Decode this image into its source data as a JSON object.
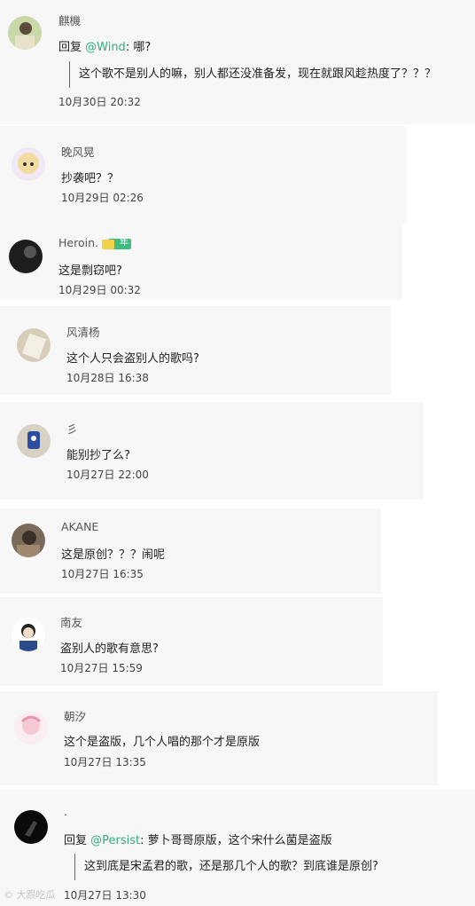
{
  "comments": [
    {
      "user": "麒機",
      "reply_prefix": "回复 ",
      "mention": "@Wind",
      "after_mention": ": 哪?",
      "quote": "这个歌不是别人的嘛，别人都还没准备发，现在就跟风趁热度了？？？",
      "time": "10月30日 20:32"
    },
    {
      "user": "晚风晃",
      "text": "抄袭吧？？",
      "time": "10月29日 02:26"
    },
    {
      "user": "Heroin.",
      "text": "这是剽窃吧?",
      "time": "10月29日 00:32",
      "badge_text": "年",
      "badge_color": "#3dbd7d"
    },
    {
      "user": "风清杨",
      "text": "这个人只会盗别人的歌吗?",
      "time": "10月28日 16:38"
    },
    {
      "user": "彡",
      "text": "能别抄了么?",
      "time": "10月27日 22:00"
    },
    {
      "user": "AKANE",
      "text": "这是原创？？？闹呢",
      "time": "10月27日 16:35"
    },
    {
      "user": "南友",
      "text": "盗别人的歌有意思?",
      "time": "10月27日 15:59"
    },
    {
      "user": "朝汐",
      "text": "这个是盗版，几个人唱的那个才是原版",
      "time": "10月27日 13:35"
    },
    {
      "user": ".",
      "reply_prefix": "回复 ",
      "mention": "@Persist",
      "after_mention": ": 萝卜哥哥原版，这个宋什么菌是盗版",
      "quote": "这到底是宋孟君的歌，还是那几个人的歌？到底谁是原创?",
      "time": "10月27日 13:30"
    }
  ],
  "watermark": "© 大跟吃瓜",
  "colors": {
    "card": "#f7f7f7",
    "mention": "#2fae7c",
    "text": "#222222",
    "meta": "#555555"
  }
}
